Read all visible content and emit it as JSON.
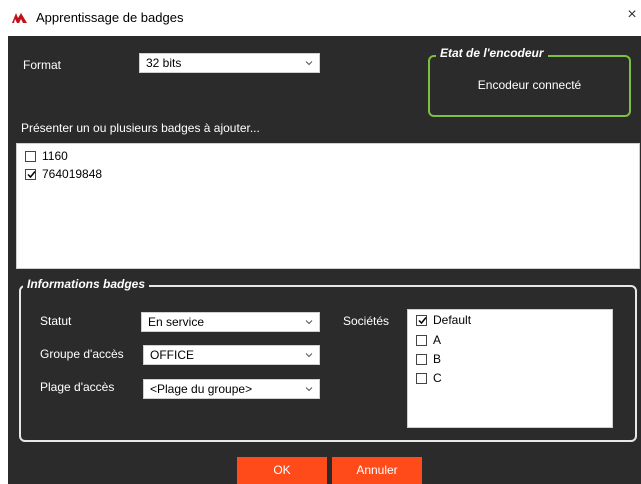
{
  "window": {
    "title": "Apprentissage de badges",
    "close_glyph": "×",
    "logo_icon": "app-logo-icon"
  },
  "format": {
    "label": "Format",
    "selected": "32 bits"
  },
  "encoder": {
    "legend": "Etat de l'encodeur",
    "status": "Encodeur connecté",
    "border_color": "#7bc043"
  },
  "badges": {
    "prompt": "Présenter un ou plusieurs badges à ajouter...",
    "items": [
      {
        "label": "1160",
        "checked": false
      },
      {
        "label": "764019848",
        "checked": true
      }
    ]
  },
  "info": {
    "legend": "Informations badges",
    "statut_label": "Statut",
    "statut_value": "En service",
    "groupe_label": "Groupe d'accès",
    "groupe_value": "OFFICE",
    "plage_label": "Plage d'accès",
    "plage_value": "<Plage du groupe>",
    "societes_label": "Sociétés",
    "societes": [
      {
        "label": "Default",
        "checked": true
      },
      {
        "label": "A",
        "checked": false
      },
      {
        "label": "B",
        "checked": false
      },
      {
        "label": "C",
        "checked": false
      }
    ]
  },
  "buttons": {
    "ok": "OK",
    "cancel": "Annuler",
    "color": "#ff4a1a"
  }
}
